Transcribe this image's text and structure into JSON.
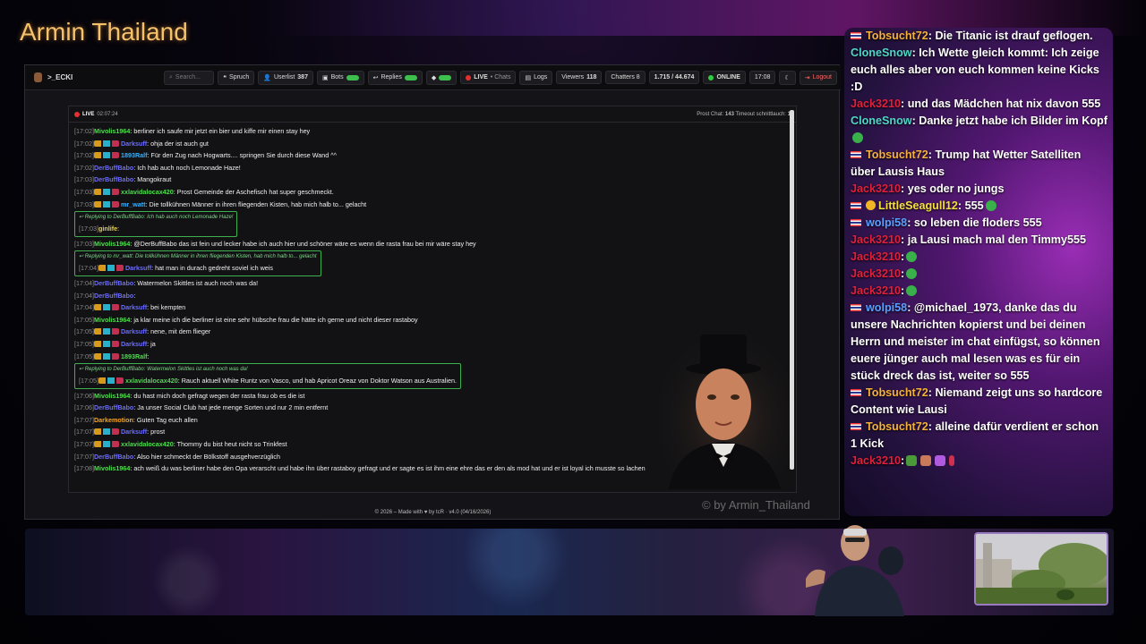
{
  "brand": "Armin Thailand",
  "nav": {
    "title": ">_ECKI",
    "search_placeholder": "Search...",
    "spruch": "Spruch",
    "userlist_label": "Userlist",
    "userlist_count": "387",
    "bots": "Bots",
    "replies": "Replies",
    "live": "LIVE",
    "chats": "• Chats",
    "logs": "Logs",
    "viewers_label": "Viewers",
    "viewers_count": "118",
    "chatters": "Chatters 8",
    "followers": "1.715 / 44.674",
    "online": "ONLINE",
    "time": "17:08",
    "logout": "Logout"
  },
  "chat_header": {
    "live": "LIVE",
    "uptime": "02:07:24",
    "stats_label": "Prost Chat:",
    "stats_value": "143",
    "timeout_label": "Timeout schnittlauch:",
    "timeout_value": "1"
  },
  "messages": [
    {
      "ts": "[17:02]",
      "user": "Mivolis1964",
      "color": "#4fdc4f",
      "badges": false,
      "text": ": berliner ich saufe mir jetzt ein bier und kiffe mir einen stay hey"
    },
    {
      "ts": "[17:02]",
      "user": "Darksuff",
      "color": "#6b6bff",
      "badges": true,
      "text": ": ohja der ist auch gut"
    },
    {
      "ts": "[17:02]",
      "user": "1893Ralf",
      "color": "#35b0ff",
      "badges": true,
      "text": ": Für den Zug nach Hogwarts.... springen Sie durch diese Wand ^^"
    },
    {
      "ts": "[17:02]",
      "user": "DerBuffBabo",
      "color": "#6b6bff",
      "badges": false,
      "text": ": Ich hab auch noch Lemonade Haze!"
    },
    {
      "ts": "[17:03]",
      "user": "DerBuffBabo",
      "color": "#6b6bff",
      "badges": false,
      "text": ": Mangokraut"
    },
    {
      "ts": "[17:03]",
      "user": "xxlavidalocax420",
      "color": "#4fdc4f",
      "badges": true,
      "text": ": Prost Gemeinde der Aschefisch hat super geschmeckt."
    },
    {
      "ts": "[17:03]",
      "user": "mr_watt",
      "color": "#35b0ff",
      "badges": true,
      "text": ": Die tollkühnen Männer in ihren fliegenden Kisten, hab mich halb to... gelacht"
    },
    {
      "ts": "[17:03]",
      "user": "ginlife",
      "color": "#e6d24a",
      "badges": false,
      "reply": "Replying to DerBuffBabo: Ich hab auch noch Lemonade Haze!",
      "text": ":"
    },
    {
      "ts": "[17:03]",
      "user": "Mivolis1964",
      "color": "#4fdc4f",
      "badges": false,
      "text": ": @DerBuffBabo das ist fein und lecker habe ich auch hier und schöner wäre es wenn die rasta frau bei mir wäre stay hey"
    },
    {
      "ts": "[17:04]",
      "user": "Darksuff",
      "color": "#6b6bff",
      "badges": true,
      "reply": "Replying to mr_watt: Die tollkühnen Männer in ihren fliegenden Kisten, hab mich halb to... gelacht",
      "text": ": hat man in durach gedreht soviel ich weis"
    },
    {
      "ts": "[17:04]",
      "user": "DerBuffBabo",
      "color": "#6b6bff",
      "badges": false,
      "text": ": Watermelon Skittles ist auch noch was da!"
    },
    {
      "ts": "[17:04]",
      "user": "DerBuffBabo",
      "color": "#6b6bff",
      "badges": false,
      "text": ":"
    },
    {
      "ts": "[17:04]",
      "user": "Darksuff",
      "color": "#6b6bff",
      "badges": true,
      "text": ": bei kempten"
    },
    {
      "ts": "[17:05]",
      "user": "Mivolis1964",
      "color": "#4fdc4f",
      "badges": false,
      "text": ": ja klar meine ich die berliner ist eine sehr hübsche frau die hätte ich gerne und nicht dieser rastaboy"
    },
    {
      "ts": "[17:05]",
      "user": "Darksuff",
      "color": "#6b6bff",
      "badges": true,
      "text": ": nene, mit dem flieger"
    },
    {
      "ts": "[17:05]",
      "user": "Darksuff",
      "color": "#6b6bff",
      "badges": true,
      "text": ": ja"
    },
    {
      "ts": "[17:05]",
      "user": "1893Ralf",
      "color": "#4fdc4f",
      "badges": true,
      "text": ":"
    },
    {
      "ts": "[17:05]",
      "user": "xxlavidalocax420",
      "color": "#4fdc4f",
      "badges": true,
      "reply": "Replying to DerBuffBabo: Watermelon Skittles ist auch noch was da!",
      "text": ": Rauch aktuell White Runtz von Vasco, und hab Apricot Oreaz von Doktor Watson aus Australien."
    },
    {
      "ts": "[17:06]",
      "user": "Mivolis1964",
      "color": "#4fdc4f",
      "badges": false,
      "text": ": du hast mich doch gefragt wegen der rasta frau ob es die ist"
    },
    {
      "ts": "[17:06]",
      "user": "DerBuffBabo",
      "color": "#6b6bff",
      "badges": false,
      "text": ": Ja unser Social Club hat jede menge Sorten und nur 2 min entfernt"
    },
    {
      "ts": "[17:07]",
      "user": "Darkemotion",
      "color": "#f5a623",
      "badges": false,
      "text": ": Guten Tag euch allen"
    },
    {
      "ts": "[17:07]",
      "user": "Darksuff",
      "color": "#6b6bff",
      "badges": true,
      "text": ": prost"
    },
    {
      "ts": "[17:07]",
      "user": "xxlavidalocax420",
      "color": "#4fdc4f",
      "badges": true,
      "text": ": Thommy du bist heut nicht so Trinkfest"
    },
    {
      "ts": "[17:07]",
      "user": "DerBuffBabo",
      "color": "#6b6bff",
      "badges": false,
      "text": ": Also hier schmeckt der Bölkstoff ausgehverzüglich"
    },
    {
      "ts": "[17:08]",
      "user": "Mivolis1964",
      "color": "#4fdc4f",
      "badges": false,
      "text": ": ach weiß du was berliner habe den Opa verarscht und habe ihn über rastaboy gefragt und er sagte es ist ihm eine ehre das er den als mod hat und er ist loyal ich musste so lachen"
    }
  ],
  "watermark": "© by Armin_Thailand",
  "footer": "© 2026 – Made with ♥ by tcR · v4.0 (04/16/2026)",
  "right_chat": [
    {
      "user": "Tobsucht72",
      "color": "#f5b13a",
      "flag": true,
      "text": ": Die Titanic ist drauf geflogen."
    },
    {
      "user": "CloneSnow",
      "color": "#4fd6c8",
      "flag": false,
      "text": ": Ich Wette gleich kommt: Ich zeige euch alles aber von euch kommen keine Kicks :D"
    },
    {
      "user": "Jack3210",
      "color": "#e0203a",
      "flag": false,
      "text": ": und das Mädchen hat nix davon 555"
    },
    {
      "user": "CloneSnow",
      "color": "#4fd6c8",
      "flag": false,
      "text": ":  Danke jetzt habe ich Bilder im Kopf",
      "emote": true
    },
    {
      "user": "Tobsucht72",
      "color": "#f5b13a",
      "flag": true,
      "text": ": Trump hat Wetter Satelliten über Lausis Haus"
    },
    {
      "user": "Jack3210",
      "color": "#e0203a",
      "flag": false,
      "text": ": yes oder no jungs"
    },
    {
      "user": "LittleSeagull12",
      "color": "#f5e03a",
      "flag": true,
      "text": ": 555"
    },
    {
      "user": "wolpi58",
      "color": "#5aa0ff",
      "flag": true,
      "text": ": so leben die floders 555"
    },
    {
      "user": "Jack3210",
      "color": "#e0203a",
      "flag": false,
      "text": ": ja Lausi mach mal den Timmy555"
    },
    {
      "user": "Jack3210",
      "color": "#e0203a",
      "flag": false,
      "text": ":",
      "emote": true
    },
    {
      "user": "Jack3210",
      "color": "#e0203a",
      "flag": false,
      "text": ":",
      "emote": true
    },
    {
      "user": "Jack3210",
      "color": "#e0203a",
      "flag": false,
      "text": ":",
      "emote": true
    },
    {
      "user": "wolpi58",
      "color": "#5aa0ff",
      "flag": true,
      "text": ": @michael_1973, danke das du unsere Nachrichten kopierst und bei deinen Herrn und meister im chat einfügst, so können euere jünger auch mal lesen was es für ein stück dreck das ist, weiter so 555"
    },
    {
      "user": "Tobsucht72",
      "color": "#f5b13a",
      "flag": true,
      "text": ": Niemand zeigt uns so hardcore Content wie Lausi"
    },
    {
      "user": "Tobsucht72",
      "color": "#f5b13a",
      "flag": true,
      "text": ": alleine dafür verdient er schon 1 Kick"
    },
    {
      "user": "Jack3210",
      "color": "#e0203a",
      "flag": false,
      "text": ":"
    }
  ]
}
